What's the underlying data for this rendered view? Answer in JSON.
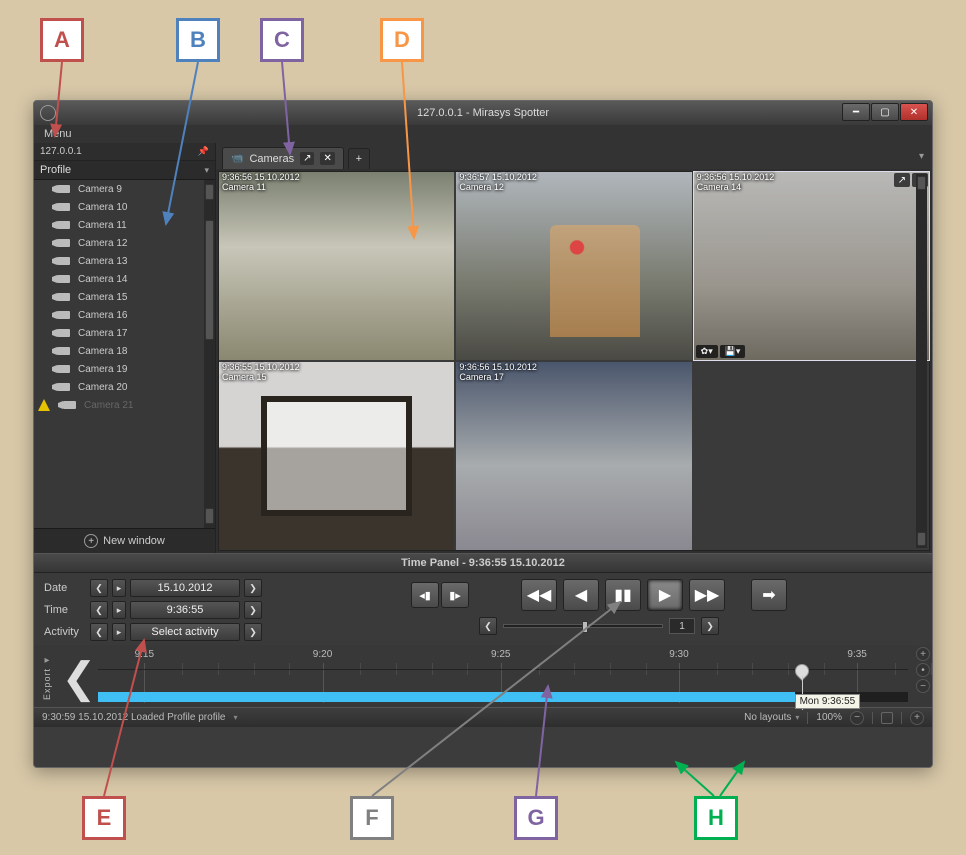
{
  "labels": {
    "A": "A",
    "B": "B",
    "C": "C",
    "D": "D",
    "E": "E",
    "F": "F",
    "G": "G",
    "H": "H"
  },
  "window": {
    "title": "127.0.0.1 - Mirasys Spotter",
    "menu": "Menu"
  },
  "sidebar": {
    "server": "127.0.0.1",
    "profile": "Profile",
    "items": [
      "Camera 9",
      "Camera 10",
      "Camera 11",
      "Camera 12",
      "Camera 13",
      "Camera 14",
      "Camera 15",
      "Camera 16",
      "Camera 17",
      "Camera 18",
      "Camera 19",
      "Camera 20",
      "Camera 21"
    ],
    "new_window": "New window"
  },
  "tabs": {
    "cameras": "Cameras"
  },
  "cams": {
    "c11": {
      "ts": "9:36:56 15.10.2012",
      "name": "Camera 11"
    },
    "c12": {
      "ts": "9:36:57 15.10.2012",
      "name": "Camera 12"
    },
    "c14": {
      "ts": "9:36:56 15.10.2012",
      "name": "Camera 14"
    },
    "c15": {
      "ts": "9:36:55 15.10.2012",
      "name": "Camera 15"
    },
    "c17": {
      "ts": "9:36:56 15.10.2012",
      "name": "Camera 17"
    }
  },
  "timepanel": {
    "header": "Time Panel - 9:36:55 15.10.2012",
    "date_lbl": "Date",
    "date_val": "15.10.2012",
    "time_lbl": "Time",
    "time_val": "9:36:55",
    "act_lbl": "Activity",
    "act_val": "Select activity",
    "speed": "1"
  },
  "timeline": {
    "export": "Export",
    "ticks": [
      "9:15",
      "9:20",
      "9:25",
      "9:30",
      "9:35"
    ],
    "tooltip": "Mon 9:36:55"
  },
  "status": {
    "left": "9:30:59 15.10.2012 Loaded Profile profile",
    "layouts": "No layouts",
    "zoom": "100%"
  }
}
